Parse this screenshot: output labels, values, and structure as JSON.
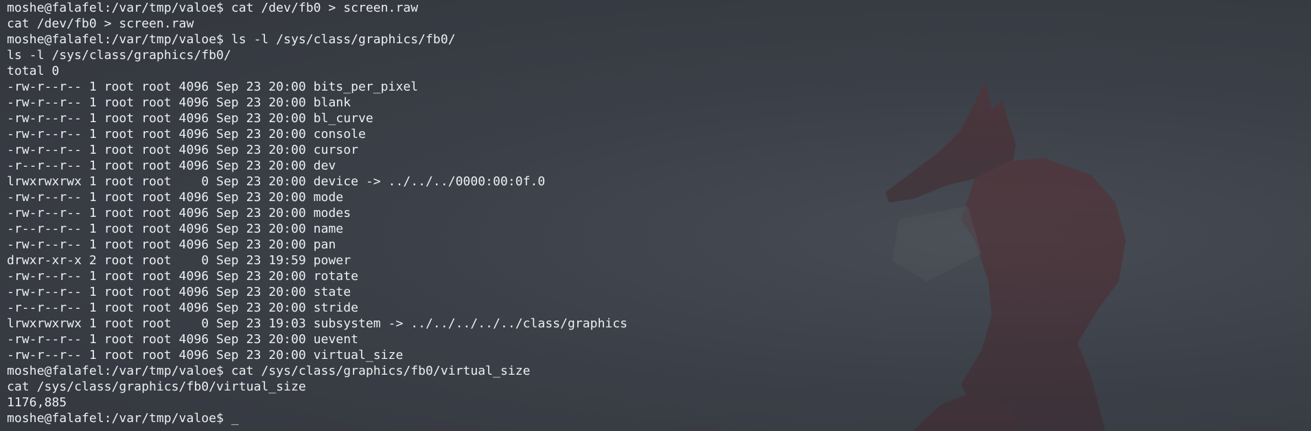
{
  "terminal": {
    "lines": [
      "moshe@falafel:/var/tmp/valoe$ cat /dev/fb0 > screen.raw",
      "cat /dev/fb0 > screen.raw",
      "moshe@falafel:/var/tmp/valoe$ ls -l /sys/class/graphics/fb0/",
      "ls -l /sys/class/graphics/fb0/",
      "total 0",
      "-rw-r--r-- 1 root root 4096 Sep 23 20:00 bits_per_pixel",
      "-rw-r--r-- 1 root root 4096 Sep 23 20:00 blank",
      "-rw-r--r-- 1 root root 4096 Sep 23 20:00 bl_curve",
      "-rw-r--r-- 1 root root 4096 Sep 23 20:00 console",
      "-rw-r--r-- 1 root root 4096 Sep 23 20:00 cursor",
      "-r--r--r-- 1 root root 4096 Sep 23 20:00 dev",
      "lrwxrwxrwx 1 root root    0 Sep 23 20:00 device -> ../../../0000:00:0f.0",
      "-rw-r--r-- 1 root root 4096 Sep 23 20:00 mode",
      "-rw-r--r-- 1 root root 4096 Sep 23 20:00 modes",
      "-r--r--r-- 1 root root 4096 Sep 23 20:00 name",
      "-rw-r--r-- 1 root root 4096 Sep 23 20:00 pan",
      "drwxr-xr-x 2 root root    0 Sep 23 19:59 power",
      "-rw-r--r-- 1 root root 4096 Sep 23 20:00 rotate",
      "-rw-r--r-- 1 root root 4096 Sep 23 20:00 state",
      "-r--r--r-- 1 root root 4096 Sep 23 20:00 stride",
      "lrwxrwxrwx 1 root root    0 Sep 23 19:03 subsystem -> ../../../../../class/graphics",
      "-rw-r--r-- 1 root root 4096 Sep 23 20:00 uevent",
      "-rw-r--r-- 1 root root 4096 Sep 23 20:00 virtual_size",
      "moshe@falafel:/var/tmp/valoe$ cat /sys/class/graphics/fb0/virtual_size",
      "cat /sys/class/graphics/fb0/virtual_size",
      "1176,885"
    ],
    "prompt": "moshe@falafel:/var/tmp/valoe$ ",
    "cursor": "_"
  },
  "colors": {
    "background": "#3a3e46",
    "text": "#eceff3",
    "fox": "#6e3434"
  },
  "wallpaper": {
    "icon": "fox-silhouette-icon"
  }
}
